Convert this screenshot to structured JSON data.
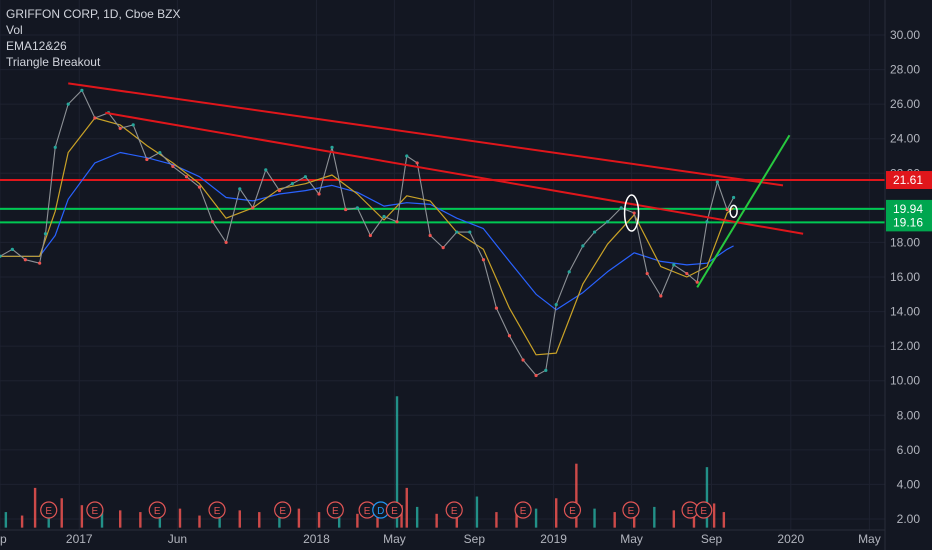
{
  "legend": {
    "symbol_line": "GRIFFON CORP, 1D, Cboe BZX",
    "indicators": [
      "Vol",
      "EMA12&26",
      "Triangle Breakout"
    ]
  },
  "colors": {
    "background": "#131722",
    "grid": "#1e2230",
    "up": "#26a69a",
    "down": "#ef5350",
    "ema_fast": "#c9a227",
    "ema_slow": "#2962ff",
    "trendline_red": "#e0161b",
    "trendline_green": "#27c93f",
    "level_red": "#e0161b",
    "level_green": "#00c853"
  },
  "chart_data": {
    "type": "line",
    "title": "GRIFFON CORP, 1D, Cboe BZX",
    "ylim": [
      1.5,
      32.5
    ],
    "y_ticks": [
      2,
      4,
      6,
      8,
      10,
      12,
      14,
      16,
      18,
      20,
      22,
      24,
      26,
      28,
      30
    ],
    "y_tick_labels": [
      "2.00",
      "4.00",
      "6.00",
      "8.00",
      "10.00",
      "12.00",
      "14.00",
      "16.00",
      "18.00",
      "20.00",
      "22.00",
      "24.00",
      "26.00",
      "28.00",
      "30.00"
    ],
    "x_range": [
      "2016-09-01",
      "2020-05-25"
    ],
    "x_ticks": [
      {
        "date": "2016-09-01",
        "label": "ep"
      },
      {
        "date": "2017-01-01",
        "label": "2017"
      },
      {
        "date": "2017-06-01",
        "label": "Jun"
      },
      {
        "date": "2018-01-01",
        "label": "2018"
      },
      {
        "date": "2018-05-01",
        "label": "May"
      },
      {
        "date": "2018-09-01",
        "label": "Sep"
      },
      {
        "date": "2019-01-01",
        "label": "2019"
      },
      {
        "date": "2019-05-01",
        "label": "May"
      },
      {
        "date": "2019-09-01",
        "label": "Sep"
      },
      {
        "date": "2020-01-01",
        "label": "2020"
      },
      {
        "date": "2020-05-01",
        "label": "May"
      }
    ],
    "series": [
      {
        "key": "price",
        "x": [
          "2016-09-01",
          "2016-09-20",
          "2016-10-10",
          "2016-11-01",
          "2016-11-10",
          "2016-11-25",
          "2016-12-15",
          "2017-01-05",
          "2017-01-25",
          "2017-02-15",
          "2017-03-05",
          "2017-03-25",
          "2017-04-15",
          "2017-05-05",
          "2017-05-25",
          "2017-06-15",
          "2017-07-05",
          "2017-07-25",
          "2017-08-15",
          "2017-09-05",
          "2017-09-25",
          "2017-10-15",
          "2017-11-05",
          "2017-11-25",
          "2017-12-15",
          "2018-01-05",
          "2018-01-25",
          "2018-02-15",
          "2018-03-05",
          "2018-03-25",
          "2018-04-15",
          "2018-05-05",
          "2018-05-20",
          "2018-06-05",
          "2018-06-25",
          "2018-07-15",
          "2018-08-05",
          "2018-08-25",
          "2018-09-15",
          "2018-10-05",
          "2018-10-25",
          "2018-11-15",
          "2018-12-05",
          "2018-12-20",
          "2019-01-05",
          "2019-01-25",
          "2019-02-15",
          "2019-03-05",
          "2019-03-25",
          "2019-04-15",
          "2019-05-05",
          "2019-05-25",
          "2019-06-15",
          "2019-07-05",
          "2019-07-25",
          "2019-08-10",
          "2019-08-25",
          "2019-09-10",
          "2019-09-25",
          "2019-10-05"
        ],
        "values": [
          17.2,
          17.6,
          17.0,
          16.8,
          18.5,
          23.5,
          26.0,
          26.8,
          25.2,
          25.5,
          24.6,
          24.8,
          22.8,
          23.2,
          22.4,
          21.8,
          21.2,
          19.2,
          18.0,
          21.1,
          20.0,
          22.2,
          21.0,
          21.4,
          21.8,
          20.8,
          23.5,
          19.9,
          20.0,
          18.4,
          19.5,
          19.2,
          23.0,
          22.6,
          18.4,
          17.7,
          18.6,
          18.6,
          17.0,
          14.2,
          12.6,
          11.2,
          10.3,
          10.6,
          14.4,
          16.3,
          17.8,
          18.6,
          19.2,
          20.0,
          19.7,
          16.2,
          14.9,
          16.7,
          16.2,
          15.7,
          19.2,
          21.5,
          19.9,
          20.6
        ]
      },
      {
        "key": "ema_fast",
        "x": [
          "2016-09-01",
          "2016-11-01",
          "2016-11-25",
          "2016-12-15",
          "2017-01-25",
          "2017-03-05",
          "2017-04-15",
          "2017-05-25",
          "2017-07-05",
          "2017-08-15",
          "2017-09-25",
          "2017-11-05",
          "2017-12-15",
          "2018-01-25",
          "2018-03-05",
          "2018-04-15",
          "2018-05-20",
          "2018-06-25",
          "2018-08-05",
          "2018-09-15",
          "2018-10-25",
          "2018-12-05",
          "2019-01-05",
          "2019-02-15",
          "2019-03-25",
          "2019-05-05",
          "2019-06-15",
          "2019-07-25",
          "2019-08-25",
          "2019-09-25",
          "2019-10-05"
        ],
        "values": [
          17.2,
          17.2,
          19.8,
          23.2,
          25.2,
          24.8,
          23.6,
          22.6,
          21.4,
          19.4,
          20.0,
          21.1,
          21.4,
          21.9,
          20.8,
          19.3,
          20.7,
          20.4,
          18.6,
          17.6,
          14.2,
          11.5,
          11.6,
          15.6,
          17.9,
          19.6,
          16.6,
          16.0,
          16.6,
          19.7,
          20.0
        ]
      },
      {
        "key": "ema_slow",
        "x": [
          "2016-09-01",
          "2016-11-01",
          "2016-11-25",
          "2016-12-15",
          "2017-01-25",
          "2017-03-05",
          "2017-04-15",
          "2017-05-25",
          "2017-07-05",
          "2017-08-15",
          "2017-09-25",
          "2017-11-05",
          "2017-12-15",
          "2018-01-25",
          "2018-03-05",
          "2018-04-15",
          "2018-05-20",
          "2018-06-25",
          "2018-08-05",
          "2018-09-15",
          "2018-10-25",
          "2018-12-05",
          "2019-01-05",
          "2019-02-15",
          "2019-03-25",
          "2019-05-05",
          "2019-06-15",
          "2019-07-25",
          "2019-08-25",
          "2019-09-25",
          "2019-10-05"
        ],
        "values": [
          17.2,
          17.2,
          18.4,
          20.5,
          22.6,
          23.2,
          22.9,
          22.5,
          21.8,
          20.6,
          20.4,
          20.8,
          21.0,
          21.3,
          20.9,
          20.1,
          20.3,
          20.2,
          19.4,
          18.8,
          16.9,
          15.0,
          14.1,
          15.1,
          16.3,
          17.4,
          16.9,
          16.7,
          16.8,
          17.6,
          17.8
        ]
      }
    ],
    "volume": {
      "x": [
        "2016-09-10",
        "2016-10-05",
        "2016-10-25",
        "2016-11-15",
        "2016-12-05",
        "2017-01-05",
        "2017-02-05",
        "2017-03-05",
        "2017-04-05",
        "2017-05-05",
        "2017-06-05",
        "2017-07-05",
        "2017-08-05",
        "2017-09-05",
        "2017-10-05",
        "2017-11-05",
        "2017-12-05",
        "2018-01-05",
        "2018-02-05",
        "2018-03-05",
        "2018-04-05",
        "2018-05-05",
        "2018-05-12",
        "2018-05-20",
        "2018-06-05",
        "2018-07-05",
        "2018-08-05",
        "2018-09-05",
        "2018-10-05",
        "2018-11-05",
        "2018-12-05",
        "2019-01-05",
        "2019-02-05",
        "2019-03-05",
        "2019-04-05",
        "2019-05-05",
        "2019-06-05",
        "2019-07-05",
        "2019-08-05",
        "2019-08-25",
        "2019-09-05",
        "2019-09-20"
      ],
      "values": [
        2.4,
        2.2,
        3.8,
        2.6,
        3.2,
        2.8,
        2.6,
        2.5,
        2.4,
        2.3,
        2.6,
        2.2,
        2.3,
        2.5,
        2.4,
        2.2,
        2.6,
        2.4,
        2.8,
        2.3,
        2.4,
        9.1,
        2.8,
        3.8,
        2.7,
        2.3,
        2.6,
        3.3,
        2.4,
        2.6,
        2.6,
        3.2,
        5.2,
        2.6,
        2.4,
        2.4,
        2.7,
        2.5,
        2.4,
        5.0,
        2.9,
        2.4
      ]
    },
    "horizontal_levels": [
      {
        "label": "21.61",
        "value": 21.61,
        "color": "red"
      },
      {
        "label": "19.94",
        "value": 19.94,
        "color": "green"
      },
      {
        "label": "19.16",
        "value": 19.16,
        "color": "green"
      }
    ],
    "trendlines": [
      {
        "x": [
          "2016-12-15",
          "2019-12-20"
        ],
        "y": [
          27.2,
          21.3
        ],
        "color": "red"
      },
      {
        "x": [
          "2017-02-10",
          "2020-01-20"
        ],
        "y": [
          25.5,
          18.5
        ],
        "color": "red"
      },
      {
        "x": [
          "2019-08-10",
          "2019-12-30"
        ],
        "y": [
          15.4,
          24.2
        ],
        "color": "green"
      }
    ],
    "earnings_markers": [
      "E",
      "E",
      "E",
      "E",
      "E",
      "E",
      "E",
      "D",
      "E",
      "E",
      "E",
      "E",
      "E",
      "E",
      "E"
    ],
    "earnings_dates": [
      "2016-11-15",
      "2017-01-25",
      "2017-05-01",
      "2017-08-01",
      "2017-11-10",
      "2018-01-30",
      "2018-03-20",
      "2018-04-10",
      "2018-05-01",
      "2018-08-01",
      "2018-11-15",
      "2019-01-30",
      "2019-04-30",
      "2019-07-30",
      "2019-08-20"
    ],
    "circle_annotations": [
      {
        "x": "2019-05-01",
        "y": 19.7
      },
      {
        "x": "2019-10-05",
        "y": 19.8
      }
    ]
  }
}
